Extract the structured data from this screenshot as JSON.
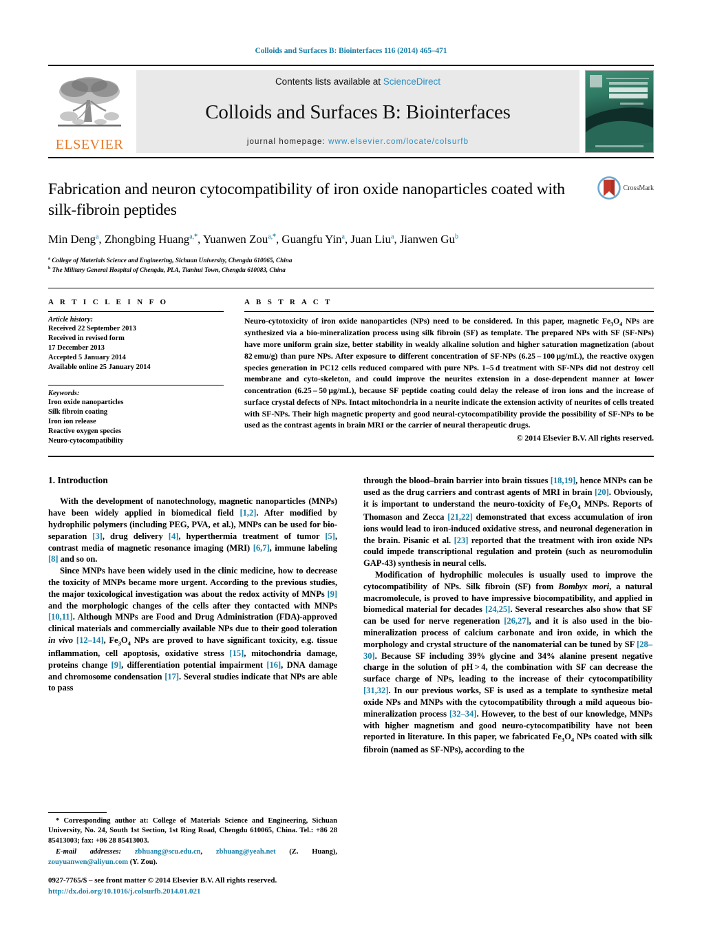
{
  "running_head": "Colloids and Surfaces B: Biointerfaces 116 (2014) 465–471",
  "masthead": {
    "publisher_name": "ELSEVIER",
    "contents_prefix": "Contents lists available at ",
    "contents_link": "ScienceDirect",
    "journal_title": "Colloids and Surfaces B: Biointerfaces",
    "homepage_prefix": "journal homepage:",
    "homepage_url": "www.elsevier.com/locate/colsurfb",
    "cover_title": "COLLOIDS AND SURFACES B",
    "link_color": "#2b8fc4"
  },
  "title": "Fabrication and neuron cytocompatibility of iron oxide nanoparticles coated with silk-fibroin peptides",
  "crossmark_label": "CrossMark",
  "authors": "Min Deng, Zhongbing Huang, Yuanwen Zou, Guangfu Yin, Juan Liu, Jianwen Gu",
  "affiliations": [
    "College of Materials Science and Engineering, Sichuan University, Chengdu 610065, China",
    "The Military General Hospital of Chengdu, PLA, Tianhui Town, Chengdu 610083, China"
  ],
  "article_info": {
    "heading": "A R T I C L E   I N F O",
    "history_label": "Article history:",
    "history": [
      "Received 22 September 2013",
      "Received in revised form",
      "17 December 2013",
      "Accepted 5 January 2014",
      "Available online 25 January 2014"
    ],
    "keywords_label": "Keywords:",
    "keywords": [
      "Iron oxide nanoparticles",
      "Silk fibroin coating",
      "Iron ion release",
      "Reactive oxygen species",
      "Neuro-cytocompatibility"
    ]
  },
  "abstract": {
    "heading": "A B S T R A C T",
    "copyright": "© 2014 Elsevier B.V. All rights reserved."
  },
  "intro": {
    "heading": "1.  Introduction"
  },
  "footnote": {
    "corresponding_star": "*",
    "corresponding_text": " Corresponding author at: College of Materials Science and Engineering, Sichuan University, No. 24, South 1st Section, 1st Ring Road, Chengdu 610065, China. Tel.: +86 28 85413003; fax: +86 28 85413003.",
    "email_label": "E-mail addresses:",
    "email1": "zbhuang@scu.edu.cn",
    "email2": "zbhuang@yeah.net",
    "email1_owner": " (Z. Huang),",
    "email3": "zouyuanwen@aliyun.com",
    "email3_owner": " (Y. Zou)."
  },
  "copyright_footer": {
    "issn_line": "0927-7765/$ – see front matter © 2014 Elsevier B.V. All rights reserved.",
    "doi": "http://dx.doi.org/10.1016/j.colsurfb.2014.01.021"
  }
}
